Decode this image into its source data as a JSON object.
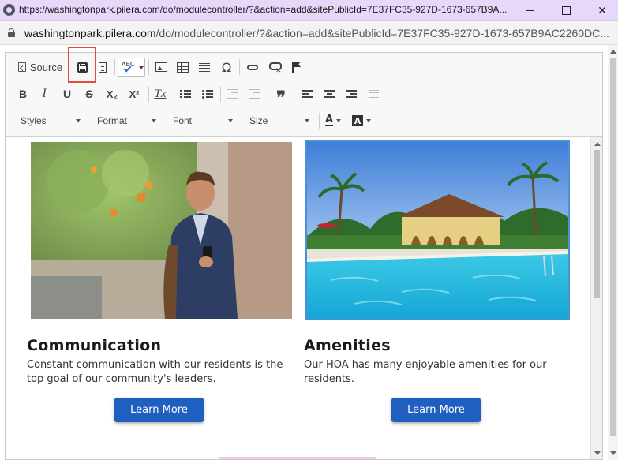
{
  "window": {
    "title": "https://washingtonpark.pilera.com/do/modulecontroller/?&action=add&sitePublicId=7E37FC35-927D-1673-657B9A...",
    "minimize_glyph": "",
    "close_glyph": "✕"
  },
  "address": {
    "host": "washingtonpark.pilera.com",
    "path": "/do/modulecontroller/?&action=add&sitePublicId=7E37FC35-927D-1673-657B9AC2260DC..."
  },
  "toolbar": {
    "source_label": "Source",
    "spell_label": "ABC",
    "special_char": "Ω",
    "bold": "B",
    "italic": "I",
    "underline": "U",
    "strike": "S",
    "subscript": "X₂",
    "superscript": "X²",
    "remove_format": "Tx",
    "styles_label": "Styles",
    "format_label": "Format",
    "font_label": "Font",
    "size_label": "Size",
    "text_color": "A",
    "bg_color": "A",
    "quote": "❞",
    "highlight_color": "#e84a3c"
  },
  "cards": [
    {
      "title": "Communication",
      "description": "Constant communication with our residents is the top goal of our community's leaders.",
      "button": "Learn More"
    },
    {
      "title": "Amenities",
      "description": "Our HOA has many enjoyable amenities for our residents.",
      "button": "Learn More"
    }
  ],
  "colors": {
    "button_bg": "#1f5fbf",
    "titlebar_bg": "#e6d7fb"
  }
}
